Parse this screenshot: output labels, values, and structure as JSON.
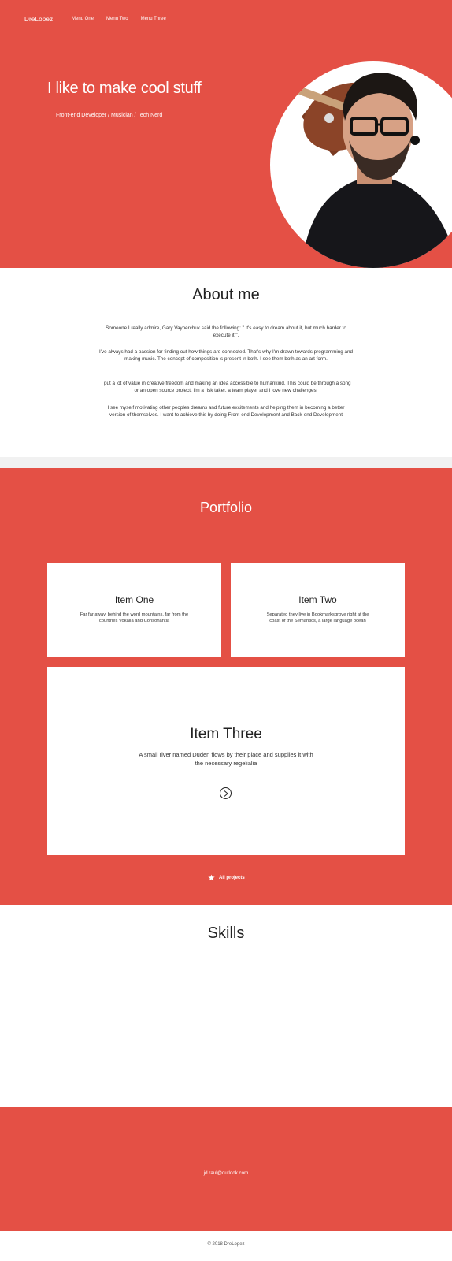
{
  "colors": {
    "accent": "#e45045",
    "background": "#ffffff",
    "band": "#f1f1f1"
  },
  "header": {
    "brand": "DreLopez",
    "nav": [
      "Menu One",
      "Menu Two",
      "Menu Three"
    ]
  },
  "hero": {
    "title": "I like to make cool stuff",
    "subtitle": "Front-end Developer / Musician / Tech Nerd"
  },
  "about": {
    "title": "About me",
    "paragraphs": [
      "Someone I really admire, Gary Vaynerchuk said the following: \" It's easy to dream about it, but much harder to execute it \".",
      "I've always had a passion for finding out how things are connected. That's why I'm drawn towards programming and making music. The concept of composition is present in both. I see them both as an art form.",
      "I put a lot of value in creative freedom and making an idea accessible to humankind. This could be through a song or an open source project. I'm a risk taker, a team player and I love new challenges.",
      "I see myself motivating other peoples dreams and future excitements and helping them in becoming a better version of themselves. I want to achieve this by doing Front-end Development and Back-end Development"
    ]
  },
  "portfolio": {
    "title": "Portfolio",
    "items": [
      {
        "title": "Item One",
        "text": "Far far away, behind the word mountains, far from the countries Vokalia and Consonantia"
      },
      {
        "title": "Item Two",
        "text": "Separated they live in Bookmarksgrove right at the coast of the Semantics, a large language ocean"
      },
      {
        "title": "Item Three",
        "text": "A small river named Duden flows by their place and supplies it with the necessary regelialia"
      }
    ],
    "all_projects_label": "All projects",
    "arrow_icon": "chevron-right-circle-icon",
    "star_icon": "star-icon"
  },
  "skills": {
    "title": "Skills"
  },
  "contact": {
    "email": "jd.raul@outlook.com"
  },
  "footer": {
    "copyright": "© 2018 DreLopez"
  }
}
